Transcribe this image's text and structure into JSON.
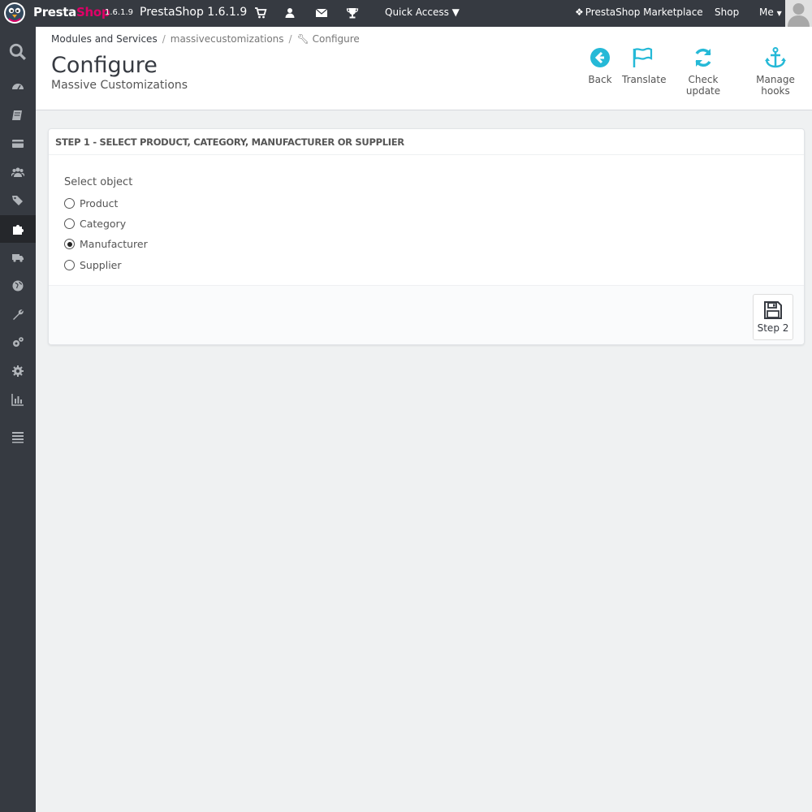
{
  "topbar": {
    "brand_presta": "Presta",
    "brand_shop": "Shop",
    "brand_version": "1.6.1.9",
    "shop_name": "PrestaShop 1.6.1.9",
    "quick_access": "Quick Access",
    "marketplace": "PrestaShop Marketplace",
    "shop_link": "Shop",
    "me_link": "Me"
  },
  "sidebar": {
    "items": [
      {
        "icon": "search-icon"
      },
      {
        "icon": "dashboard-icon"
      },
      {
        "icon": "catalog-icon"
      },
      {
        "icon": "orders-icon"
      },
      {
        "icon": "customers-icon"
      },
      {
        "icon": "price-rules-icon"
      },
      {
        "icon": "modules-icon",
        "active": true
      },
      {
        "icon": "shipping-icon"
      },
      {
        "icon": "localization-icon"
      },
      {
        "icon": "preferences-icon"
      },
      {
        "icon": "advanced-parameters-icon"
      },
      {
        "icon": "administration-icon"
      },
      {
        "icon": "stats-icon"
      },
      {
        "icon": "menu-collapse-icon"
      }
    ]
  },
  "header": {
    "breadcrumb": [
      "Modules and Services",
      "massivecustomizations",
      "Configure"
    ],
    "title": "Configure",
    "subtitle": "Massive Customizations",
    "toolbar": {
      "back": "Back",
      "translate": "Translate",
      "check_update": "Check update",
      "manage_hooks": "Manage hooks"
    }
  },
  "panel": {
    "heading": "STEP 1 - SELECT PRODUCT, CATEGORY, MANUFACTURER OR SUPPLIER",
    "select_label": "Select object",
    "options": [
      {
        "label": "Product",
        "checked": false
      },
      {
        "label": "Category",
        "checked": false
      },
      {
        "label": "Manufacturer",
        "checked": true
      },
      {
        "label": "Supplier",
        "checked": false
      }
    ],
    "step2_label": "Step 2"
  },
  "colors": {
    "accent": "#25b9d7",
    "dark_bar": "#363a41",
    "brand_pink": "#df0067"
  }
}
